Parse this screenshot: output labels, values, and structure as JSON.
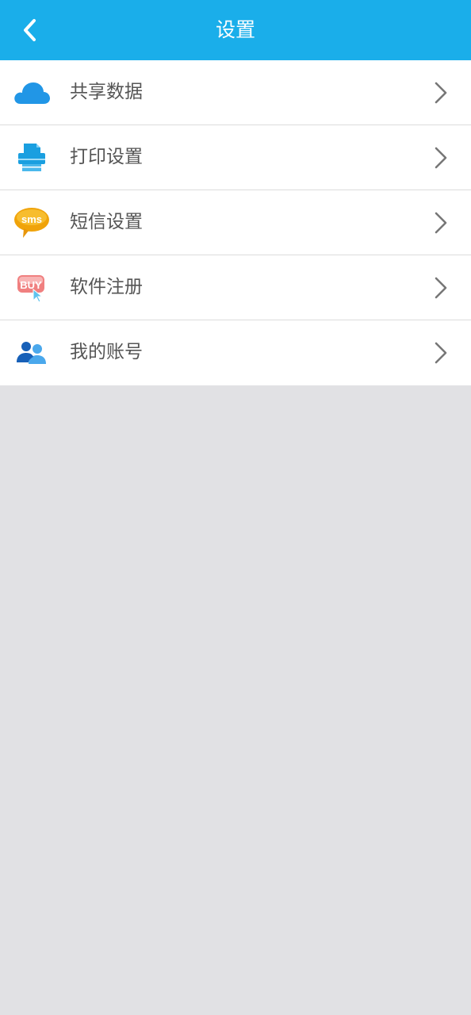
{
  "header": {
    "title": "设置",
    "back_icon": "chevron-left-icon",
    "background_color": "#1aaeea"
  },
  "menu": {
    "items": [
      {
        "label": "共享数据",
        "icon": "cloud-icon"
      },
      {
        "label": "打印设置",
        "icon": "printer-icon"
      },
      {
        "label": "短信设置",
        "icon": "sms-bubble-icon",
        "icon_text": "sms"
      },
      {
        "label": "软件注册",
        "icon": "buy-icon",
        "icon_text": "BUY"
      },
      {
        "label": "我的账号",
        "icon": "users-icon"
      }
    ],
    "chevron_icon": "chevron-right-icon"
  }
}
